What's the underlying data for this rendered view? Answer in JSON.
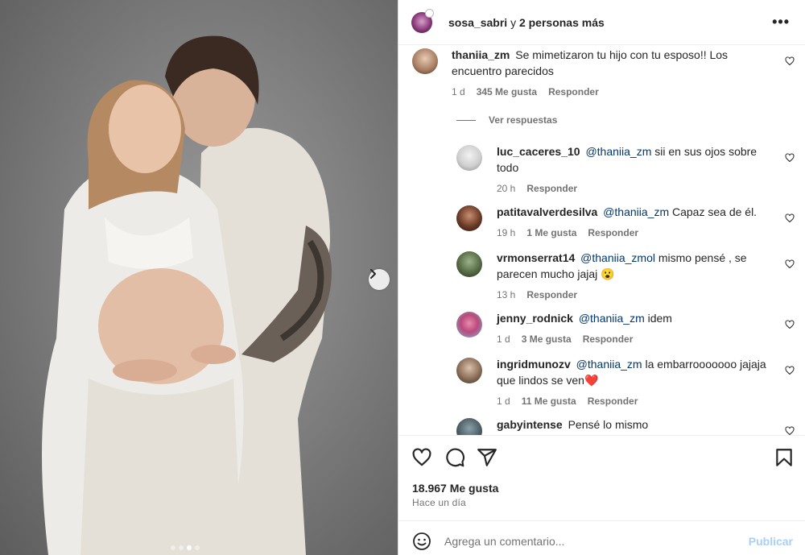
{
  "header": {
    "username": "sosa_sabri",
    "connector": "y",
    "others": "2 personas más",
    "more_icon": "more-horizontal-icon"
  },
  "comments": {
    "main": {
      "username": "thaniia_zm",
      "text_line1": "Se mimetizaron tu hijo con tu esposo!! Los",
      "text_line2": "encuentro parecidos",
      "time": "1 d",
      "likes": "345 Me gusta",
      "reply": "Responder"
    },
    "view_replies": "Ver respuestas",
    "replies": [
      {
        "username": "luc_caceres_10",
        "mention": "@thaniia_zm",
        "text_line1": "sii en sus ojos sobre",
        "text_line2": "todo",
        "time": "20 h",
        "likes": "",
        "reply": "Responder"
      },
      {
        "username": "patitavalverdesilva",
        "mention": "@thaniia_zm",
        "text_line1": "Capaz sea de él.",
        "time": "19 h",
        "likes": "1 Me gusta",
        "reply": "Responder"
      },
      {
        "username": "vrmonserrat14",
        "mention": "@thaniia_zmol",
        "text_line1": "mismo pensé , se",
        "text_line2": "parecen mucho jajaj 😮",
        "time": "13 h",
        "likes": "",
        "reply": "Responder"
      },
      {
        "username": "jenny_rodnick",
        "mention": "@thaniia_zm",
        "text_line1": "idem",
        "time": "1 d",
        "likes": "3 Me gusta",
        "reply": "Responder"
      },
      {
        "username": "ingridmunozv",
        "mention": "@thaniia_zm",
        "text_line1": "la embarrooooooo jajaja",
        "text_line2": "que lindos se ven❤️",
        "time": "1 d",
        "likes": "11 Me gusta",
        "reply": "Responder"
      },
      {
        "username": "gabyintense",
        "mention": "",
        "text_line1": "Pensé lo mismo"
      }
    ]
  },
  "actions": {
    "icons": [
      "heart-icon",
      "comment-icon",
      "share-icon",
      "bookmark-icon"
    ],
    "likes_count": "18.967 Me gusta",
    "posted": "Hace un día"
  },
  "add_comment": {
    "placeholder": "Agrega un comentario...",
    "publish_label": "Publicar",
    "emoji_icon": "emoji-icon"
  },
  "carousel": {
    "dots": 4,
    "active_index": 2
  },
  "colors": {
    "mention": "#00376b",
    "secondary_text": "#737373",
    "publish_disabled": "#a8cffa",
    "border": "#dbdbdb"
  }
}
